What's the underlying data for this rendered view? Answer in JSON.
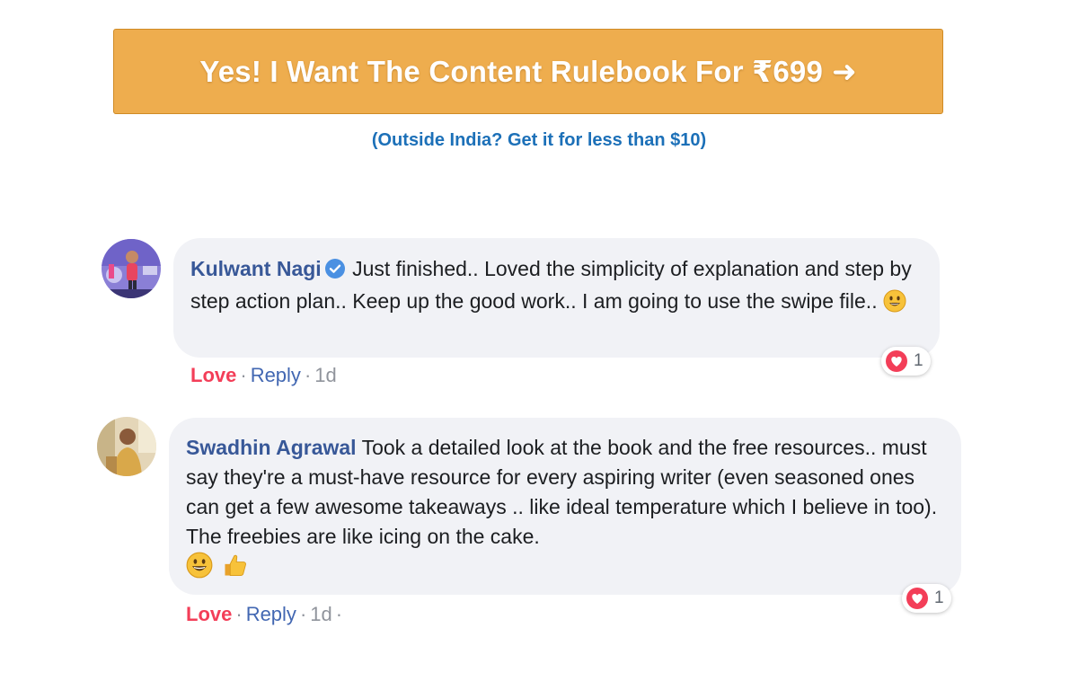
{
  "cta": {
    "label": "Yes! I Want The Content Rulebook For ₹699",
    "arrow": "➜",
    "color": "#eead4e"
  },
  "outside_link": "(Outside India? Get it for less than $10)",
  "comments": [
    {
      "name": "Kulwant Nagi",
      "verified": true,
      "text": "Just finished.. Loved the simplicity of explanation and step by step action plan.. Keep up the good work.. I am going to use the swipe file..",
      "emojis": [
        "smiley-emoji"
      ],
      "reaction_label": "Love",
      "reply_label": "Reply",
      "separator": "·",
      "time": "1d",
      "trailing": "",
      "reaction_count": "1"
    },
    {
      "name": "Swadhin Agrawal",
      "verified": false,
      "text": "Took a detailed look at the book and the free resources.. must say they're a must-have resource for every aspiring writer (even seasoned ones can get a few awesome takeaways .. like ideal temperature which I believe in too). The freebies are like icing on the cake.",
      "emojis": [
        "grinning-emoji",
        "thumbs-up-emoji"
      ],
      "reaction_label": "Love",
      "reply_label": "Reply",
      "separator": "·",
      "time": "1d",
      "trailing": "·",
      "reaction_count": "1"
    }
  ],
  "colors": {
    "name": "#385898",
    "love": "#f33e58",
    "reply": "#4267b2",
    "link": "#1c70b8",
    "bubble": "#f1f2f6"
  }
}
